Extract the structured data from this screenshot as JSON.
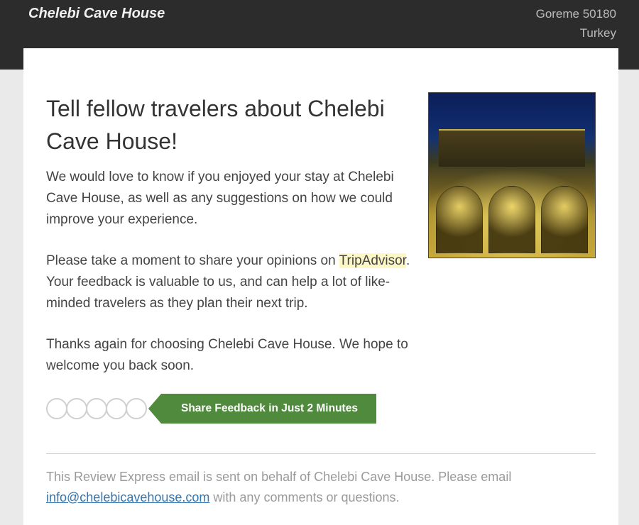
{
  "header": {
    "hotel_name": "Chelebi Cave House",
    "address_line1": "Goreme 50180",
    "address_line2": "Turkey"
  },
  "main": {
    "heading": "Tell fellow travelers about Chelebi Cave House!",
    "para1": "We would love to know if you enjoyed your stay at Chelebi Cave House, as well as any suggestions on how we could improve your experience.",
    "para2_pre": "Please take a moment to share your opinions on ",
    "para2_highlight": "TripAdvisor",
    "para2_post": ". Your feedback is valuable to us, and can help a lot of like-minded travelers as they plan their next trip.",
    "para3": "Thanks again for choosing Chelebi Cave House. We hope to welcome you back soon."
  },
  "cta": {
    "button_label": "Share Feedback in Just 2 Minutes",
    "rating_count": 5
  },
  "footer": {
    "text_pre": "This Review Express email is sent on behalf of Chelebi Cave House. Please email ",
    "email": "info@chelebicavehouse.com",
    "text_post": " with any comments or questions."
  }
}
